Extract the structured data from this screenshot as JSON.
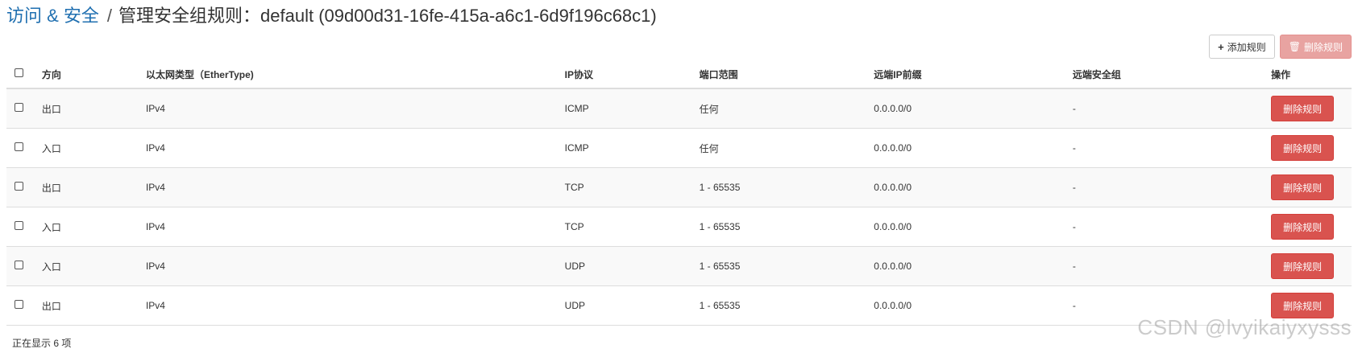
{
  "breadcrumb": {
    "parent": "访问 & 安全",
    "separator": "/",
    "current": "管理安全组规则：default (09d00d31-16fe-415a-a6c1-6d9f196c68c1)"
  },
  "toolbar": {
    "add_label": "添加规则",
    "add_icon": "plus-icon",
    "delete_label": "删除规则",
    "delete_icon": "trash-icon"
  },
  "table": {
    "headers": {
      "direction": "方向",
      "ethertype": "以太网类型（EtherType)",
      "protocol": "IP协议",
      "port_range": "端口范围",
      "remote_prefix": "远端IP前缀",
      "remote_group": "远端安全组",
      "actions": "操作"
    },
    "rows": [
      {
        "direction": "出口",
        "ethertype": "IPv4",
        "protocol": "ICMP",
        "port_range": "任何",
        "remote_prefix": "0.0.0.0/0",
        "remote_group": "-",
        "action": "删除规则"
      },
      {
        "direction": "入口",
        "ethertype": "IPv4",
        "protocol": "ICMP",
        "port_range": "任何",
        "remote_prefix": "0.0.0.0/0",
        "remote_group": "-",
        "action": "删除规则"
      },
      {
        "direction": "出口",
        "ethertype": "IPv4",
        "protocol": "TCP",
        "port_range": "1 - 65535",
        "remote_prefix": "0.0.0.0/0",
        "remote_group": "-",
        "action": "删除规则"
      },
      {
        "direction": "入口",
        "ethertype": "IPv4",
        "protocol": "TCP",
        "port_range": "1 - 65535",
        "remote_prefix": "0.0.0.0/0",
        "remote_group": "-",
        "action": "删除规则"
      },
      {
        "direction": "入口",
        "ethertype": "IPv4",
        "protocol": "UDP",
        "port_range": "1 - 65535",
        "remote_prefix": "0.0.0.0/0",
        "remote_group": "-",
        "action": "删除规则"
      },
      {
        "direction": "出口",
        "ethertype": "IPv4",
        "protocol": "UDP",
        "port_range": "1 - 65535",
        "remote_prefix": "0.0.0.0/0",
        "remote_group": "-",
        "action": "删除规则"
      }
    ]
  },
  "footer": {
    "count_text": "正在显示 6 项"
  },
  "watermark": "CSDN @lvyikaiyxysss",
  "colors": {
    "link": "#1f6fb0",
    "danger": "#d9534f",
    "danger_disabled": "#e8a3a1"
  }
}
